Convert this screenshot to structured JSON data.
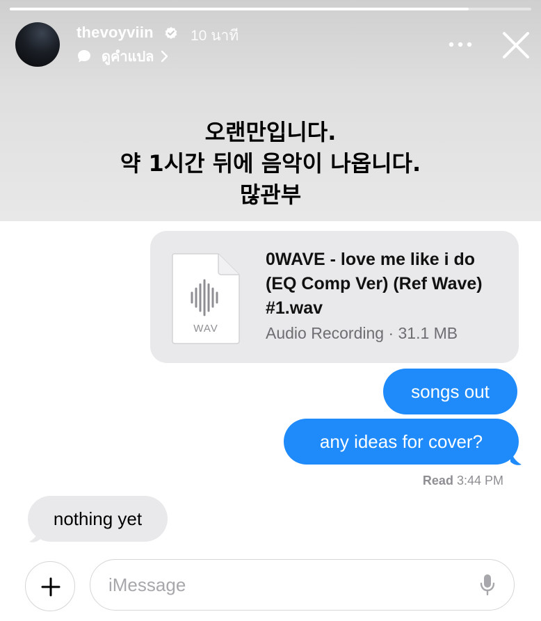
{
  "story": {
    "progress": 0.88,
    "username": "thevoyviin",
    "time_ago": "10 นาที",
    "translate_label": "ดูคำแปล",
    "headline_lines": [
      "오랜만입니다.",
      "약 1시간 뒤에 음악이 나옵니다.",
      "많관부"
    ]
  },
  "chat": {
    "attachment": {
      "file_type": "WAV",
      "file_name": "0WAVE - love me like i do (EQ Comp Ver) (Ref Wave) #1.wav",
      "meta": "Audio Recording · 31.1 MB"
    },
    "messages": [
      {
        "direction": "sent",
        "text": "songs out"
      },
      {
        "direction": "sent",
        "text": "any ideas for cover?"
      },
      {
        "direction": "received",
        "text": "nothing yet"
      }
    ],
    "read_receipt": {
      "label": "Read",
      "time": "3:44 PM"
    }
  },
  "composer": {
    "placeholder": "iMessage"
  },
  "colors": {
    "sent_bubble": "#1f8bfb",
    "received_bubble": "#e9e9eb",
    "verified_badge": "#ffffff"
  },
  "icons": {
    "verified": "verified-badge-icon",
    "translate": "speech-bubble-icon",
    "chevron": "chevron-right-icon",
    "more": "more-horizontal-icon",
    "close": "close-icon",
    "file": "audio-file-icon",
    "plus": "plus-icon",
    "mic": "microphone-icon"
  }
}
